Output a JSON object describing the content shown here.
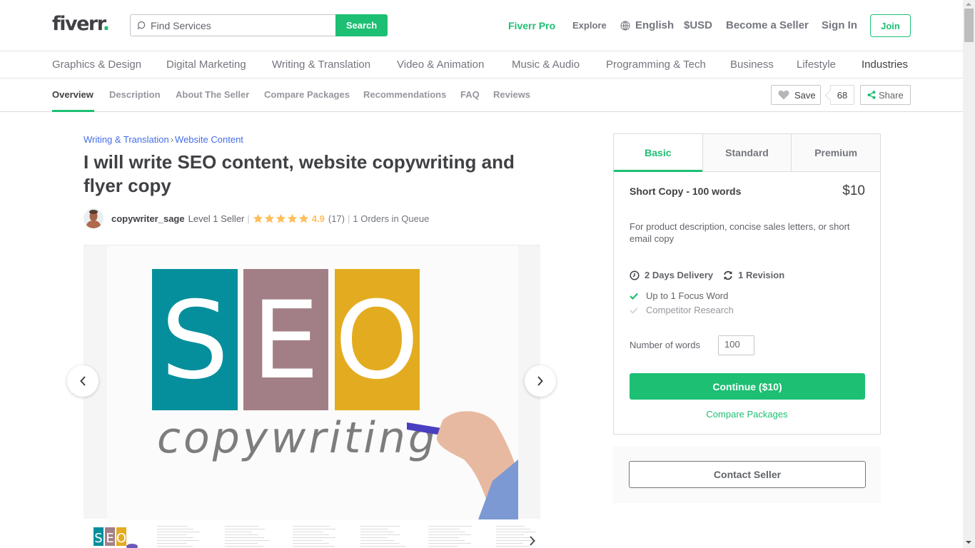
{
  "header": {
    "logo_text": "fiverr",
    "logo_dot": ".",
    "search_placeholder": "Find Services",
    "search_button": "Search",
    "nav": {
      "pro": "Fiverr Pro",
      "explore": "Explore",
      "language": "English",
      "currency": "$USD",
      "become_seller": "Become a Seller",
      "sign_in": "Sign In",
      "join": "Join"
    }
  },
  "categories": [
    "Graphics & Design",
    "Digital Marketing",
    "Writing & Translation",
    "Video & Animation",
    "Music & Audio",
    "Programming & Tech",
    "Business",
    "Lifestyle",
    "Industries"
  ],
  "subnav": {
    "tabs": [
      "Overview",
      "Description",
      "About The Seller",
      "Compare Packages",
      "Recommendations",
      "FAQ",
      "Reviews"
    ],
    "active": "Overview",
    "save_label": "Save",
    "save_count": "68",
    "share_label": "Share"
  },
  "gig": {
    "breadcrumb": [
      "Writing & Translation",
      "Website Content"
    ],
    "breadcrumb_sep": "›",
    "title": "I will write SEO content, website copywriting and flyer copy",
    "seller": {
      "username": "copywriter_sage",
      "level": "Level 1 Seller",
      "rating": "4.9",
      "stars": 5,
      "review_count": "(17)",
      "queue": "1 Orders in Queue"
    },
    "gallery": {
      "image_letters": [
        "S",
        "E",
        "O"
      ],
      "image_caption": "copywriting",
      "colors": {
        "teal": "#058f9c",
        "mauve": "#a27f86",
        "gold": "#e3ac20"
      },
      "thumbnail_count": 7
    }
  },
  "package": {
    "tabs": [
      "Basic",
      "Standard",
      "Premium"
    ],
    "active_tab": "Basic",
    "name": "Short Copy - 100 words",
    "price": "$10",
    "description": "For product description, concise sales letters, or short email copy",
    "delivery": "2 Days Delivery",
    "revisions": "1 Revision",
    "features": [
      {
        "label": "Up to 1 Focus Word",
        "included": true
      },
      {
        "label": "Competitor Research",
        "included": false
      }
    ],
    "words_label": "Number of words",
    "words_value": "100",
    "continue_label": "Continue ($10)",
    "compare_label": "Compare Packages"
  },
  "contact": {
    "label": "Contact Seller"
  },
  "colors": {
    "brand_green": "#1dbf73",
    "link_blue": "#446ee7",
    "star_yellow": "#ffbe5b"
  }
}
